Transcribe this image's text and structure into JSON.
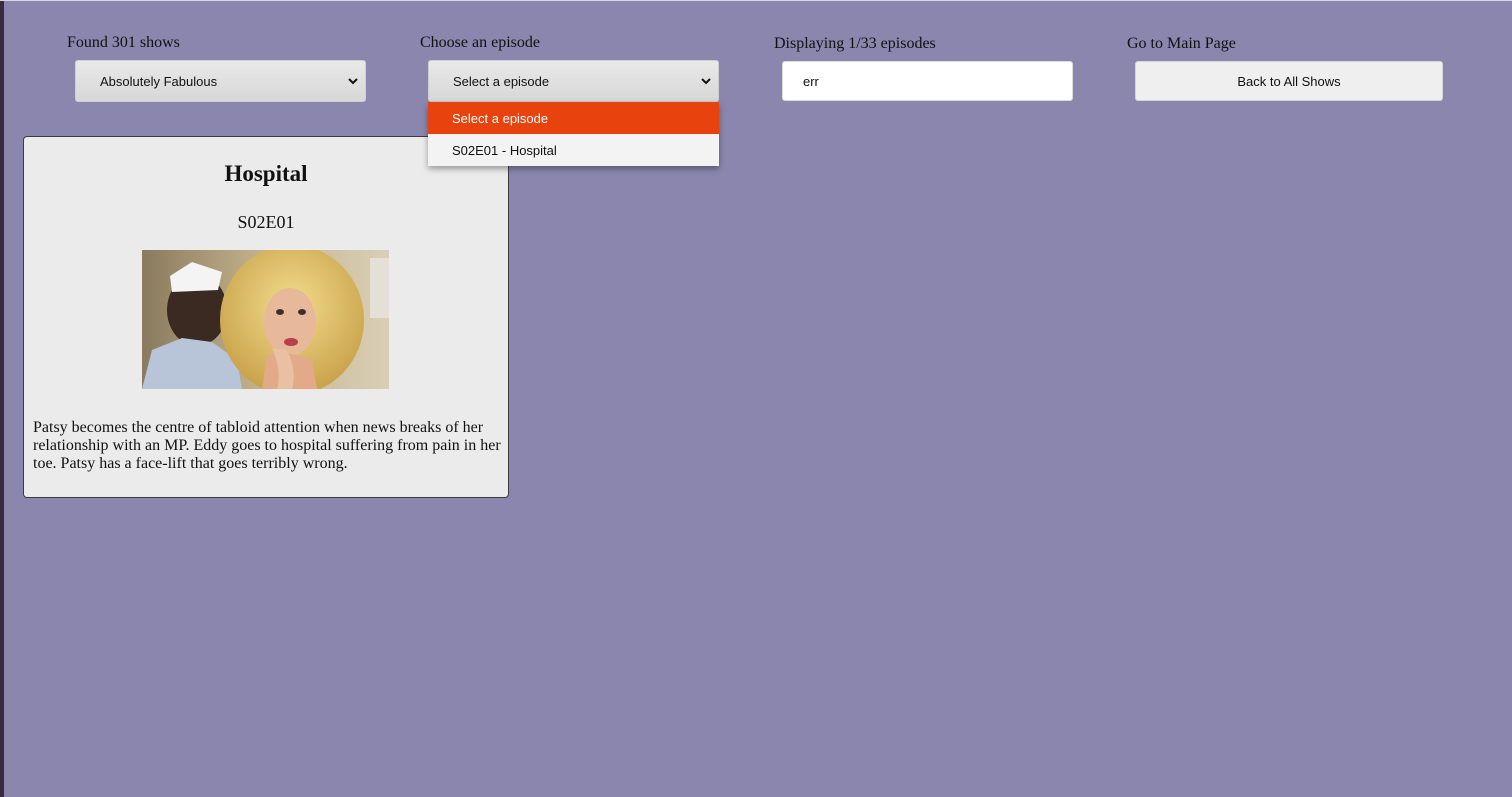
{
  "controls": {
    "shows_label": "Found 301 shows",
    "show_selected": "Absolutely Fabulous",
    "episode_label": "Choose an episode",
    "episode_selected": "Select a episode",
    "episode_options": [
      "Select a episode",
      "S02E01 - Hospital"
    ],
    "search_label": "Displaying 1/33 episodes",
    "search_value": "err",
    "main_label": "Go to Main Page",
    "back_button": "Back to All Shows"
  },
  "episode": {
    "title": "Hospital",
    "code": "S02E01",
    "summary": "Patsy becomes the centre of tabloid attention when news breaks of her relationship with an MP. Eddy goes to hospital suffering from pain in her toe. Patsy has a face-lift that goes terribly wrong."
  },
  "colors": {
    "background": "#8a86ae",
    "highlight": "#e8420f",
    "card": "#ebebeb"
  },
  "icons": {
    "select_arrow": "chevron-down-icon"
  }
}
